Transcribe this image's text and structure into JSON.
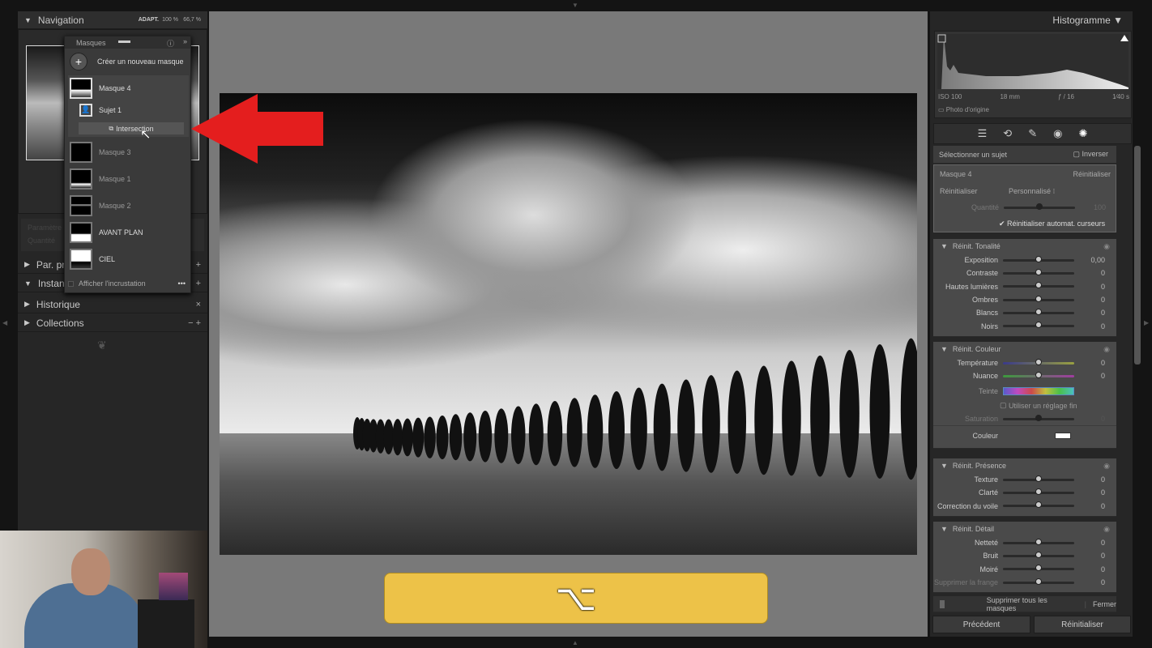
{
  "left": {
    "navigation": "Navigation",
    "zoom_options": [
      "ADAPT.",
      "100 %",
      "66,7 %"
    ],
    "masks_panel": {
      "title": "Masques",
      "create": "Créer un nouveau masque",
      "items": [
        {
          "label": "Masque 4",
          "selected": true
        },
        {
          "label": "Sujet 1",
          "sub": true
        },
        {
          "label": "Intersection",
          "button": true
        },
        {
          "label": "Masque 3"
        },
        {
          "label": "Masque 1"
        },
        {
          "label": "Masque 2"
        },
        {
          "label": "AVANT PLAN"
        },
        {
          "label": "CIEL"
        }
      ],
      "overlay": "Afficher l'incrustation"
    },
    "hidden_param": "Paramètre",
    "hidden_qty": "Quantité",
    "sections": [
      {
        "label": "Par. pré",
        "action": "+"
      },
      {
        "label": "Instanta",
        "action": "+"
      },
      {
        "label": "Historique",
        "action": "×"
      },
      {
        "label": "Collections",
        "action": "− +"
      }
    ]
  },
  "right": {
    "histogram": "Histogramme",
    "iso": "ISO 100",
    "focal": "18 mm",
    "aperture": "ƒ / 16",
    "shutter": "1⁄40 s",
    "original": "Photo d'origine",
    "select_subject": "Sélectionner un sujet",
    "invert": "Inverser",
    "mask_name": "Masque 4",
    "reset": "Réinitialiser",
    "reset_label": "Réinitialiser",
    "preset": "Personnalisé",
    "quantity": "Quantité",
    "quantity_value": "100",
    "quantity_pct": 50,
    "auto_reset": "Réinitialiser automat. curseurs",
    "groups": [
      {
        "title": "Réinit. Tonalité",
        "sliders": [
          {
            "label": "Exposition",
            "value": "0,00"
          },
          {
            "label": "Contraste",
            "value": "0"
          },
          {
            "label": "Hautes lumières",
            "value": "0"
          },
          {
            "label": "Ombres",
            "value": "0"
          },
          {
            "label": "Blancs",
            "value": "0"
          },
          {
            "label": "Noirs",
            "value": "0"
          }
        ]
      },
      {
        "title": "Réinit. Couleur",
        "sliders": [
          {
            "label": "Température",
            "value": "0"
          },
          {
            "label": "Nuance",
            "value": "0"
          }
        ],
        "tint": "Teinte",
        "fine": "Utiliser un réglage fin",
        "saturation": "Saturation",
        "saturation_value": "0",
        "color": "Couleur"
      },
      {
        "title": "Réinit. Présence",
        "sliders": [
          {
            "label": "Texture",
            "value": "0"
          },
          {
            "label": "Clarté",
            "value": "0"
          },
          {
            "label": "Correction du voile",
            "value": "0"
          }
        ]
      },
      {
        "title": "Réinit. Détail",
        "sliders": [
          {
            "label": "Netteté",
            "value": "0"
          },
          {
            "label": "Bruit",
            "value": "0"
          },
          {
            "label": "Moiré",
            "value": "0"
          },
          {
            "label": "Supprimer la frange",
            "value": "0"
          }
        ]
      }
    ],
    "delete_all": "Supprimer tous les masques",
    "close": "Fermer",
    "previous": "Précédent",
    "reset_all": "Réinitialiser"
  },
  "overlay_key": "⌥",
  "colors": {
    "key_box": "#edc248",
    "arrow": "#e41e1e"
  }
}
